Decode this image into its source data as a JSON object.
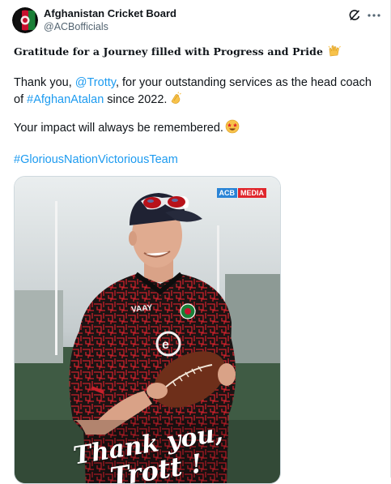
{
  "author": {
    "name": "Afghanistan Cricket Board",
    "handle": "@ACBofficials"
  },
  "post": {
    "headline": "Gratitude for a Journey filled with Progress and Pride",
    "p1_start": "Thank you, ",
    "mention": "@Trotty",
    "p1_mid": ", for your outstanding services as the head coach of ",
    "hashtag1": "#AfghanAtalan",
    "p1_end": " since 2022.",
    "p2": "Your impact will always be remembered.",
    "hashtag2": "#GloriousNationVictoriousTeam"
  },
  "media": {
    "badge_left": "ACB",
    "badge_right": "MEDIA",
    "shirt_brand": "VAAY",
    "caption_line1": "Thank you,",
    "caption_line2": "Trott !"
  },
  "icons": {
    "avatar": "acb-logo-icon",
    "grok": "grok-icon",
    "more": "more-icon",
    "raised_hands": "raising-hands-emoji",
    "clapping": "clapping-hands-emoji",
    "star_struck": "star-struck-emoji"
  },
  "colors": {
    "link": "#1d9bf0",
    "text": "#0f1419",
    "handle": "#536471",
    "badge_blue": "#2a84d6",
    "badge_red": "#e0262c"
  }
}
